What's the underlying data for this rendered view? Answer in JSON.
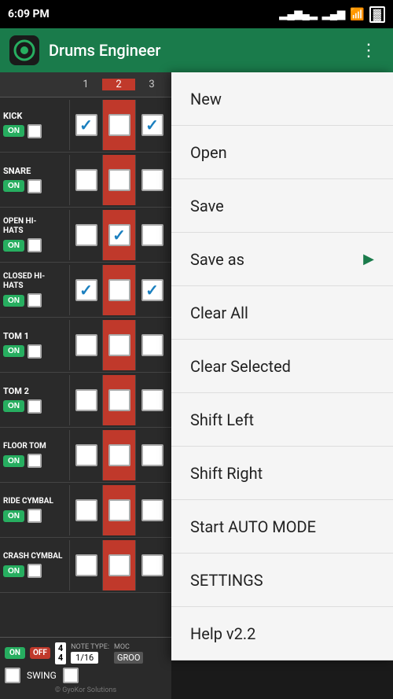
{
  "statusBar": {
    "time": "6:09 PM",
    "signalBars": "▂▄▆",
    "wifiIcon": "wifi",
    "batteryIcon": "battery"
  },
  "header": {
    "title": "Drums Engineer",
    "logoIcon": "drums-logo",
    "menuIcon": "more-vert-icon"
  },
  "drumTracks": [
    {
      "name": "KICK",
      "on": true,
      "off": false,
      "beats": [
        {
          "col": 1,
          "checked": true,
          "red": false
        },
        {
          "col": 2,
          "checked": false,
          "red": true
        },
        {
          "col": 3,
          "checked": true,
          "red": false
        }
      ]
    },
    {
      "name": "SNARE",
      "on": true,
      "off": false,
      "beats": [
        {
          "col": 1,
          "checked": false,
          "red": false
        },
        {
          "col": 2,
          "checked": false,
          "red": true
        },
        {
          "col": 3,
          "checked": false,
          "red": false
        }
      ]
    },
    {
      "name": "OPEN HI-HATS",
      "on": true,
      "off": false,
      "beats": [
        {
          "col": 1,
          "checked": false,
          "red": false
        },
        {
          "col": 2,
          "checked": true,
          "red": true
        },
        {
          "col": 3,
          "checked": false,
          "red": false
        }
      ]
    },
    {
      "name": "CLOSED HI-HATS",
      "on": true,
      "off": false,
      "beats": [
        {
          "col": 1,
          "checked": true,
          "red": false
        },
        {
          "col": 2,
          "checked": false,
          "red": true
        },
        {
          "col": 3,
          "checked": true,
          "red": false
        }
      ]
    },
    {
      "name": "TOM 1",
      "on": true,
      "off": false,
      "beats": [
        {
          "col": 1,
          "checked": false,
          "red": false
        },
        {
          "col": 2,
          "checked": false,
          "red": true
        },
        {
          "col": 3,
          "checked": false,
          "red": false
        }
      ]
    },
    {
      "name": "TOM 2",
      "on": true,
      "off": false,
      "beats": [
        {
          "col": 1,
          "checked": false,
          "red": false
        },
        {
          "col": 2,
          "checked": false,
          "red": true
        },
        {
          "col": 3,
          "checked": false,
          "red": false
        }
      ]
    },
    {
      "name": "FLOOR TOM",
      "on": true,
      "off": false,
      "beats": [
        {
          "col": 1,
          "checked": false,
          "red": false
        },
        {
          "col": 2,
          "checked": false,
          "red": true
        },
        {
          "col": 3,
          "checked": false,
          "red": false
        }
      ]
    },
    {
      "name": "RIDE CYMBAL",
      "on": true,
      "off": false,
      "beats": [
        {
          "col": 1,
          "checked": false,
          "red": false
        },
        {
          "col": 2,
          "checked": false,
          "red": true
        },
        {
          "col": 3,
          "checked": false,
          "red": false
        }
      ]
    },
    {
      "name": "CRASH CYMBAL",
      "on": true,
      "off": false,
      "beats": [
        {
          "col": 1,
          "checked": false,
          "red": false
        },
        {
          "col": 2,
          "checked": false,
          "red": true
        },
        {
          "col": 3,
          "checked": false,
          "red": false
        }
      ]
    }
  ],
  "columnHeaders": [
    "1",
    "2",
    "3"
  ],
  "bottomBar": {
    "timeSigTop": "4",
    "timeSigBottom": "4",
    "noteTypeLabel": "NOTE TYPE:",
    "noteTypeVal": "1/16",
    "modeLabel": "MOC",
    "modeVal": "GROO",
    "swingLabel": "SWING"
  },
  "menu": {
    "items": [
      {
        "label": "New",
        "hasArrow": false
      },
      {
        "label": "Open",
        "hasArrow": false
      },
      {
        "label": "Save",
        "hasArrow": false
      },
      {
        "label": "Save as",
        "hasArrow": true
      },
      {
        "label": "Clear All",
        "hasArrow": false
      },
      {
        "label": "Clear Selected",
        "hasArrow": false
      },
      {
        "label": "Shift Left",
        "hasArrow": false
      },
      {
        "label": "Shift Right",
        "hasArrow": false
      },
      {
        "label": "Start AUTO MODE",
        "hasArrow": false
      },
      {
        "label": "SETTINGS",
        "hasArrow": false
      },
      {
        "label": "Help v2.2",
        "hasArrow": false
      }
    ]
  },
  "copyright": "© GyoKor Solutions"
}
